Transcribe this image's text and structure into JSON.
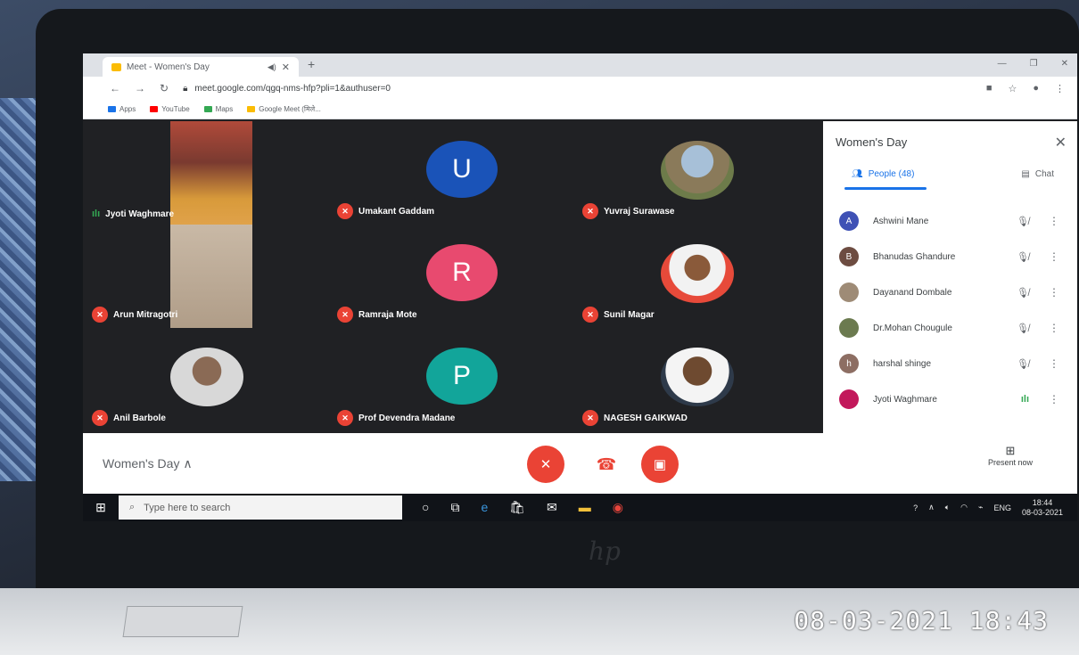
{
  "photo": {
    "timestamp": "08-03-2021 18:43"
  },
  "browser": {
    "tab_title": "Meet - Women's Day",
    "url": "meet.google.com/qgq-nms-hfp?pli=1&authuser=0",
    "bookmarks": [
      "Apps",
      "YouTube",
      "Maps",
      "Google Meet (मिले..."
    ]
  },
  "meet": {
    "tiles": [
      {
        "name": "Jyoti Waghmare",
        "state": "speaking",
        "kind": "video"
      },
      {
        "name": "Umakant Gaddam",
        "state": "muted",
        "kind": "initial",
        "initial": "U",
        "color": "#1a53b8"
      },
      {
        "name": "Yuvraj Surawase",
        "state": "muted",
        "kind": "photo"
      },
      {
        "name": "Arun Mitragotri",
        "state": "muted",
        "kind": "video"
      },
      {
        "name": "Ramraja Mote",
        "state": "muted",
        "kind": "initial",
        "initial": "R",
        "color": "#e84a6f"
      },
      {
        "name": "Sunil Magar",
        "state": "muted",
        "kind": "photo"
      },
      {
        "name": "Anil Barbole",
        "state": "muted",
        "kind": "photo"
      },
      {
        "name": "Prof Devendra Madane",
        "state": "muted",
        "kind": "initial",
        "initial": "P",
        "color": "#12a59a"
      },
      {
        "name": "NAGESH GAIKWAD",
        "state": "muted",
        "kind": "photo"
      }
    ],
    "panel": {
      "title": "Women's Day",
      "people_tab": "People (48)",
      "chat_tab": "Chat",
      "participants": [
        {
          "initial": "A",
          "name": "Ashwini Mane",
          "color": "#3f51b5",
          "mic": "muted"
        },
        {
          "initial": "B",
          "name": "Bhanudas Ghandure",
          "color": "#6d4c41",
          "mic": "muted"
        },
        {
          "initial": "",
          "name": "Dayanand Dombale",
          "color": "#9e8b76",
          "mic": "muted"
        },
        {
          "initial": "",
          "name": "Dr.Mohan Chougule",
          "color": "#6b7a4f",
          "mic": "muted"
        },
        {
          "initial": "h",
          "name": "harshal shinge",
          "color": "#8d6e63",
          "mic": "muted"
        },
        {
          "initial": "",
          "name": "Jyoti Waghmare",
          "color": "#c2185b",
          "mic": "speaking"
        }
      ]
    },
    "bottom": {
      "meeting_name": "Women's Day",
      "present_label": "Present now"
    }
  },
  "taskbar": {
    "search_placeholder": "Type here to search",
    "lang": "ENG",
    "time": "18:44",
    "date": "08-03-2021"
  }
}
